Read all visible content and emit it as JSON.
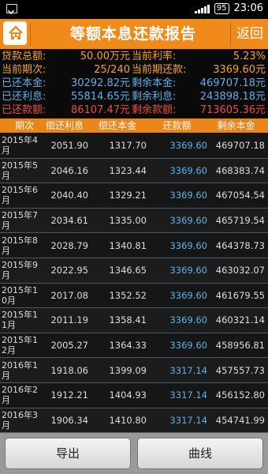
{
  "status": {
    "battery": "95",
    "time": "23:06"
  },
  "header": {
    "title": "等额本息还款报告",
    "back_label": "返回"
  },
  "summary": [
    {
      "label1": "贷款总额:",
      "value1": "50.00万元",
      "label2": "当前利率:",
      "value2": "5.23%"
    },
    {
      "label1": "当前期次:",
      "value1": "25/240",
      "label2": "当前期还款:",
      "value2": "3369.60元"
    },
    {
      "label1": "已还本金:",
      "value1": "30292.82元",
      "label2": "剩余本金:",
      "value2": "469707.18元"
    },
    {
      "label1": "已还利息:",
      "value1": "55814.65元",
      "label2": "剩余利息:",
      "value2": "243898.18元"
    },
    {
      "label1": "已还款额:",
      "value1": "86107.47元",
      "label2": "剩余款额:",
      "value2": "713605.36元"
    }
  ],
  "table": {
    "headers": [
      "期次",
      "偿还利息",
      "偿还本金",
      "还款额",
      "剩余本金"
    ],
    "rows": [
      [
        "2015年4月",
        "2051.90",
        "1317.70",
        "3369.60",
        "469707.18"
      ],
      [
        "2015年5月",
        "2046.16",
        "1323.44",
        "3369.60",
        "468383.74"
      ],
      [
        "2015年6月",
        "2040.40",
        "1329.21",
        "3369.60",
        "467054.54"
      ],
      [
        "2015年7月",
        "2034.61",
        "1335.00",
        "3369.60",
        "465719.54"
      ],
      [
        "2015年8月",
        "2028.79",
        "1340.81",
        "3369.60",
        "464378.73"
      ],
      [
        "2015年9月",
        "2022.95",
        "1346.65",
        "3369.60",
        "463032.07"
      ],
      [
        "2015年10月",
        "2017.08",
        "1352.52",
        "3369.60",
        "461679.55"
      ],
      [
        "2015年11月",
        "2011.19",
        "1358.41",
        "3369.60",
        "460321.14"
      ],
      [
        "2015年12月",
        "2005.27",
        "1364.33",
        "3369.60",
        "458956.81"
      ],
      [
        "2016年1月",
        "1918.06",
        "1399.09",
        "3317.14",
        "457557.73"
      ],
      [
        "2016年2月",
        "1912.21",
        "1404.93",
        "3317.14",
        "456152.80"
      ],
      [
        "2016年3月",
        "1906.34",
        "1410.80",
        "3317.14",
        "454741.99"
      ]
    ]
  },
  "footer": {
    "export_label": "导出",
    "chart_label": "曲线"
  }
}
